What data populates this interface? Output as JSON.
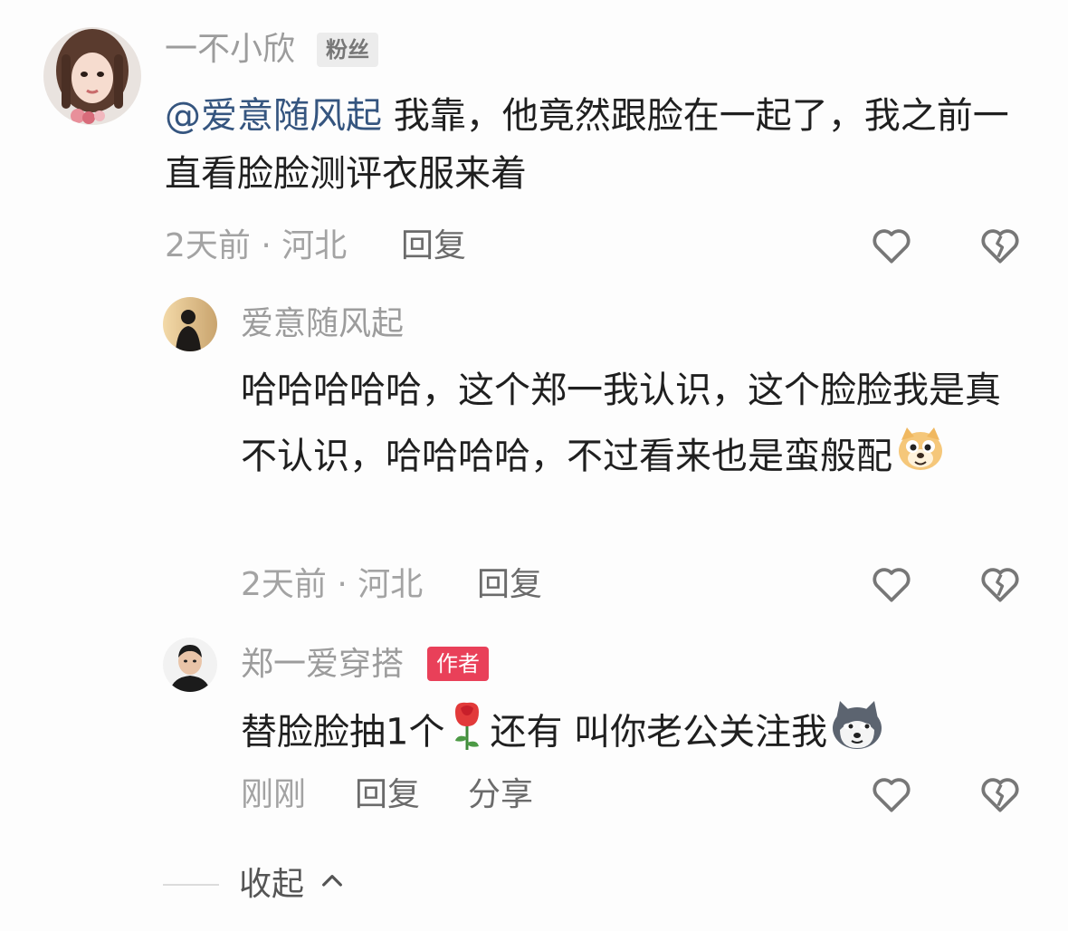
{
  "comments": [
    {
      "username": "一不小欣",
      "badge": "粉丝",
      "mention": "@爱意随风起",
      "text": "我靠，他竟然跟脸在一起了，我之前一直看脸脸测评衣服来着",
      "time": "2天前",
      "location": "河北",
      "meta": "2天前 · 河北",
      "reply_label": "回复"
    },
    {
      "username": "爱意随风起",
      "text": "哈哈哈哈哈，这个郑一我认识，这个脸脸我是真不认识，哈哈哈哈，不过看来也是蛮般配",
      "emoji": "dog-emoji",
      "time": "2天前",
      "location": "河北",
      "meta": "2天前 · 河北",
      "reply_label": "回复"
    },
    {
      "username": "郑一爱穿搭",
      "badge": "作者",
      "text_before": "替脸脸抽1个",
      "emoji_rose": "rose-emoji",
      "text_after": "还有 叫你老公关注我",
      "emoji_end": "husky-emoji",
      "time": "刚刚",
      "reply_label": "回复",
      "share_label": "分享"
    }
  ],
  "collapse_label": "收起",
  "collapse_icon": "chevron-up-icon",
  "icons": {
    "like": "heart-icon",
    "dislike": "broken-heart-icon"
  },
  "colors": {
    "mention": "#35557f",
    "author_badge": "#e94059",
    "meta": "#a3a3a3"
  }
}
